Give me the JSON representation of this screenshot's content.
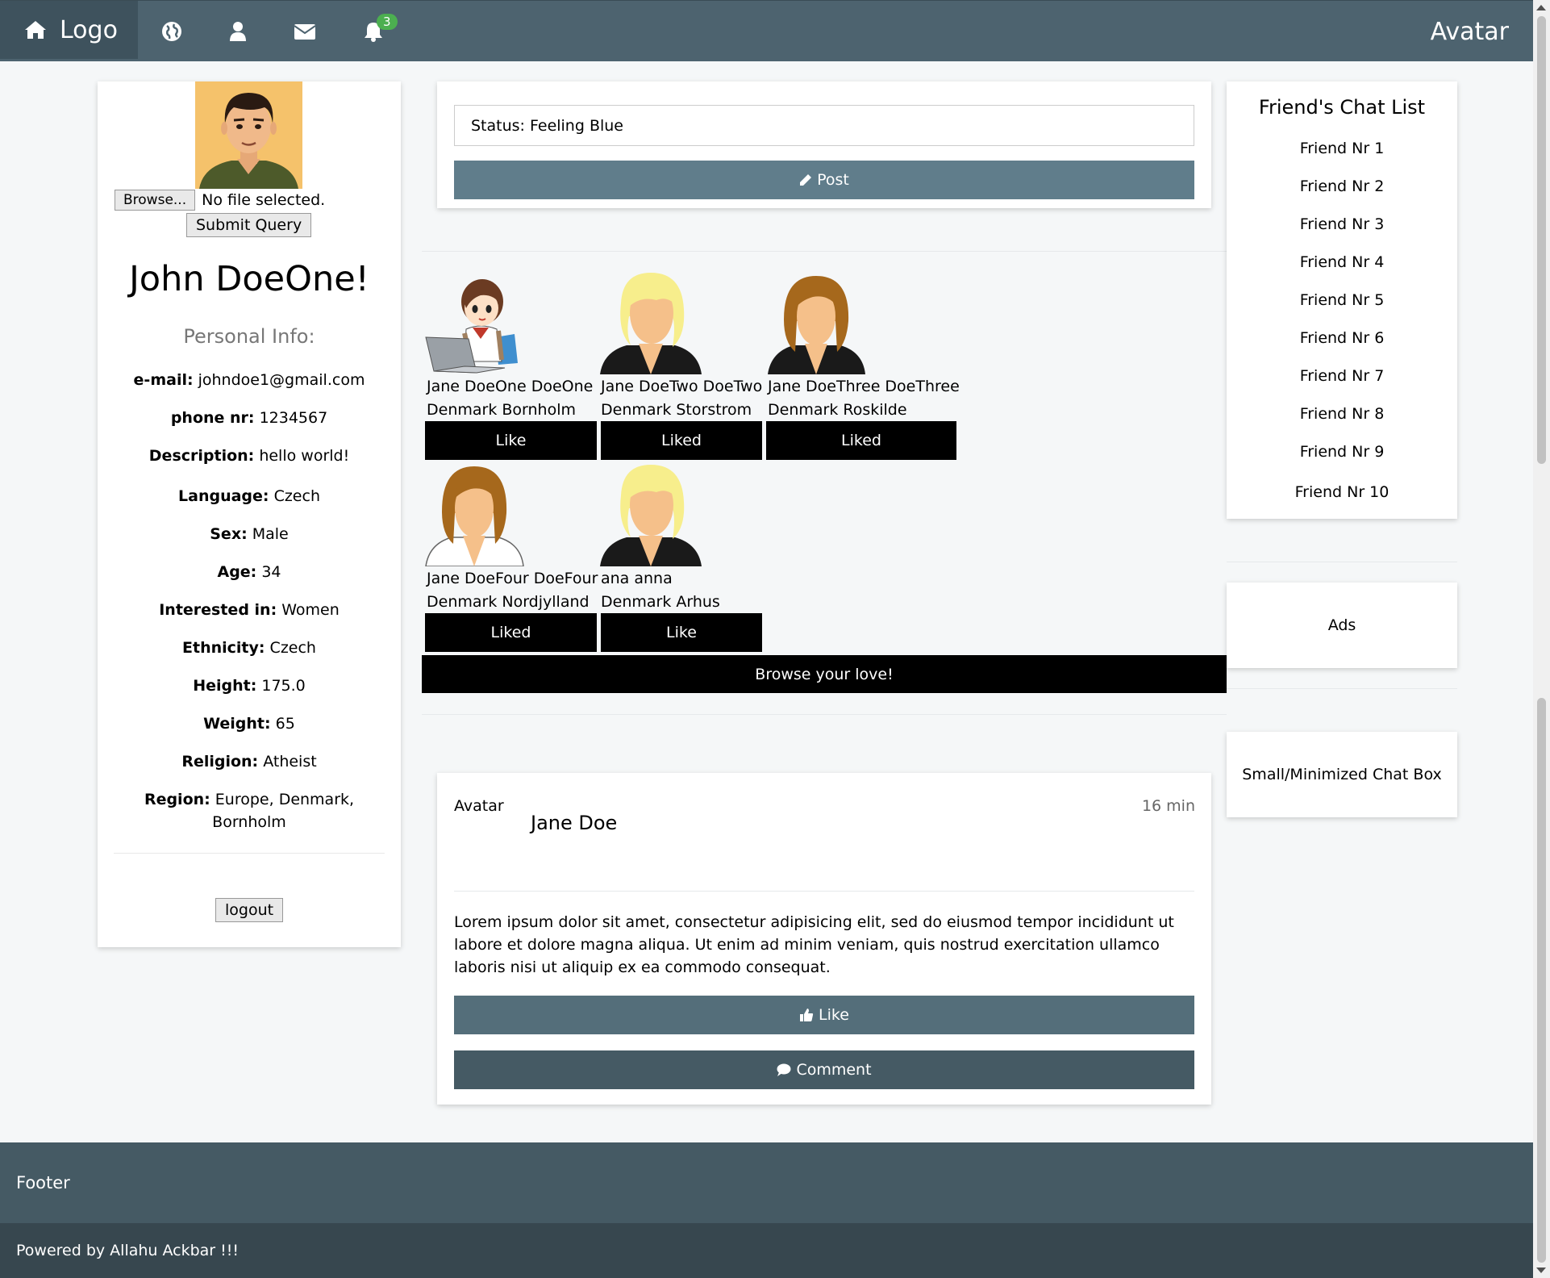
{
  "nav": {
    "brand": "Logo",
    "notification_count": "3",
    "avatar": "Avatar",
    "icons": [
      "home-icon",
      "globe-icon",
      "user-icon",
      "envelope-icon",
      "bell-icon"
    ]
  },
  "profile": {
    "browse_label": "Browse...",
    "file_status": "No file selected.",
    "submit_label": "Submit Query",
    "name": "John DoeOne!",
    "personal_info_heading": "Personal Info:",
    "fields": [
      {
        "label": "e-mail:",
        "value": "johndoe1@gmail.com"
      },
      {
        "label": "phone nr:",
        "value": "1234567"
      },
      {
        "label": "Description:",
        "value": "hello world!"
      },
      {
        "label": "Language:",
        "value": "Czech"
      },
      {
        "label": "Sex:",
        "value": "Male"
      },
      {
        "label": "Age:",
        "value": "34"
      },
      {
        "label": "Interested in:",
        "value": "Women"
      },
      {
        "label": "Ethnicity:",
        "value": "Czech"
      },
      {
        "label": "Height:",
        "value": "175.0"
      },
      {
        "label": "Weight:",
        "value": "65"
      },
      {
        "label": "Religion:",
        "value": "Atheist"
      },
      {
        "label": "Region:",
        "value": "Europe, Denmark,",
        "value2": "Bornholm"
      }
    ],
    "logout_label": "logout"
  },
  "status": {
    "input_value": "Status: Feeling Blue",
    "post_label": "Post"
  },
  "matches": [
    {
      "name": "Jane DoeOne DoeOne",
      "location": "Denmark Bornholm",
      "button": "Like"
    },
    {
      "name": "Jane DoeTwo DoeTwo",
      "location": "Denmark Storstrom",
      "button": "Liked"
    },
    {
      "name": "Jane DoeThree DoeThree",
      "location": "Denmark Roskilde",
      "button": "Liked"
    },
    {
      "name": "Jane DoeFour DoeFour",
      "location": "Denmark Nordjylland",
      "button": "Liked"
    },
    {
      "name": "ana anna",
      "location": "Denmark Arhus",
      "button": "Like"
    }
  ],
  "browse_love": "Browse your love!",
  "post": {
    "avatar": "Avatar",
    "author": "Jane Doe",
    "time": "16 min",
    "text": "Lorem ipsum dolor sit amet, consectetur adipisicing elit, sed do eiusmod tempor incididunt ut labore et dolore magna aliqua. Ut enim ad minim veniam, quis nostrud exercitation ullamco laboris nisi ut aliquip ex ea commodo consequat.",
    "like_label": "Like",
    "comment_label": "Comment"
  },
  "chat_list": {
    "title": "Friend's Chat List",
    "friends": [
      "Friend Nr 1",
      "Friend Nr 2",
      "Friend Nr 3",
      "Friend Nr 4",
      "Friend Nr 5",
      "Friend Nr 6",
      "Friend Nr 7",
      "Friend Nr 8",
      "Friend Nr 9",
      "Friend Nr 10"
    ]
  },
  "ads": "Ads",
  "chat_box": "Small/Minimized Chat Box",
  "footer": {
    "title": "Footer",
    "powered": "Powered by Allahu Ackbar !!!"
  },
  "colors": {
    "navbar": "#4d636f",
    "brand_bg": "#3e525d",
    "post_button": "#607d8b",
    "like_button": "#546e7a",
    "comment_button": "#455a64",
    "footer_top": "#455a64",
    "footer_bottom": "#37474f",
    "badge": "#4caf50"
  }
}
